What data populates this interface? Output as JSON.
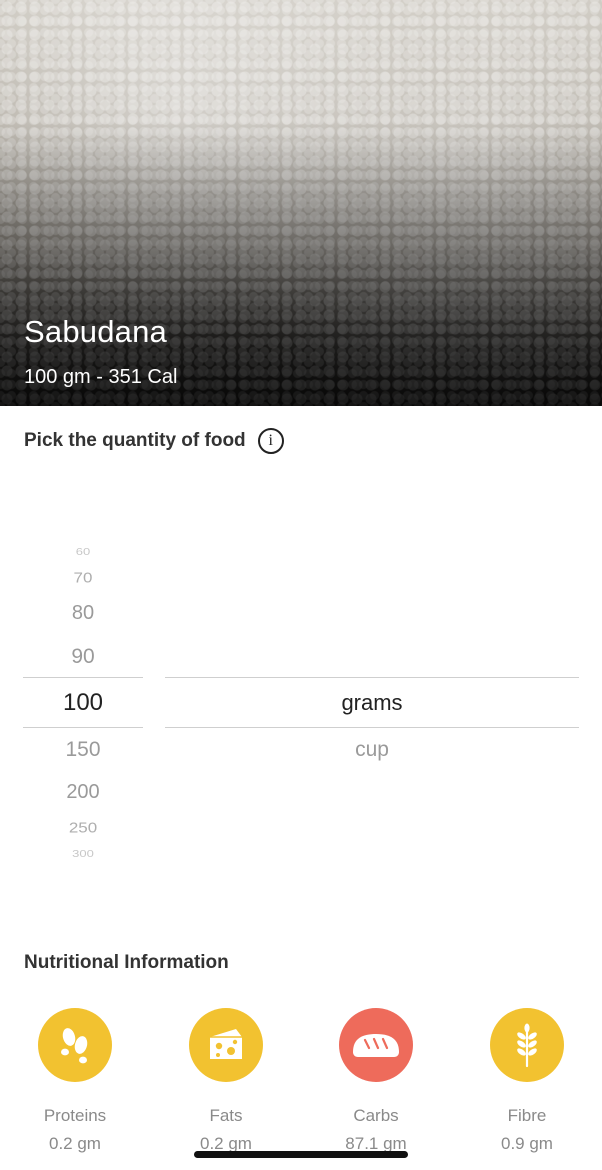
{
  "hero": {
    "title": "Sabudana",
    "subtitle": "100 gm - 351 Cal"
  },
  "quantity": {
    "title": "Pick the quantity of food",
    "info_icon": "info-icon",
    "options": [
      "60",
      "70",
      "80",
      "90",
      "100",
      "150",
      "200",
      "250",
      "300"
    ],
    "selected": "100",
    "units": [
      "grams",
      "cup"
    ],
    "selected_unit": "grams"
  },
  "nutrition": {
    "title": "Nutritional Information",
    "items": [
      {
        "label": "Proteins",
        "value": "0.2 gm",
        "icon": "footprints-icon",
        "color": "#F2C230"
      },
      {
        "label": "Fats",
        "value": "0.2 gm",
        "icon": "cheese-icon",
        "color": "#F2C230"
      },
      {
        "label": "Carbs",
        "value": "87.1 gm",
        "icon": "bread-icon",
        "color": "#EE6B5B"
      },
      {
        "label": "Fibre",
        "value": "0.9 gm",
        "icon": "wheat-icon",
        "color": "#F2C230"
      }
    ]
  }
}
